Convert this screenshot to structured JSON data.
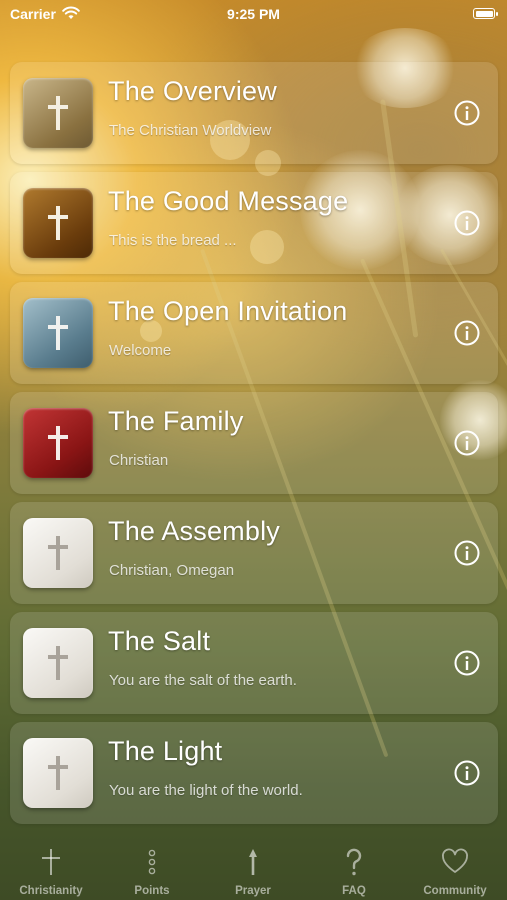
{
  "status_bar": {
    "carrier": "Carrier",
    "time": "9:25 PM"
  },
  "items": [
    {
      "title": "The Overview",
      "subtitle": "The Christian Worldview",
      "color": "#a48a5a"
    },
    {
      "title": "The Good Message",
      "subtitle": "This is the bread ...",
      "color": "#7a4b12"
    },
    {
      "title": "The Open Invitation",
      "subtitle": "Welcome",
      "color": "#5f8192"
    },
    {
      "title": "The Family",
      "subtitle": "Christian",
      "color": "#8a1515"
    },
    {
      "title": "The Assembly",
      "subtitle": "Christian, Omegan",
      "color": "#e6e3dc"
    },
    {
      "title": "The Salt",
      "subtitle": "You are the salt of the earth.",
      "color": "#e6e3dc"
    },
    {
      "title": "The Light",
      "subtitle": "You are the light of the world.",
      "color": "#e6e3dc"
    }
  ],
  "tabs": [
    {
      "label": "Christianity",
      "icon": "cross-icon"
    },
    {
      "label": "Points",
      "icon": "dots-icon"
    },
    {
      "label": "Prayer",
      "icon": "arrow-up-icon"
    },
    {
      "label": "FAQ",
      "icon": "question-icon"
    },
    {
      "label": "Community",
      "icon": "heart-icon"
    }
  ]
}
